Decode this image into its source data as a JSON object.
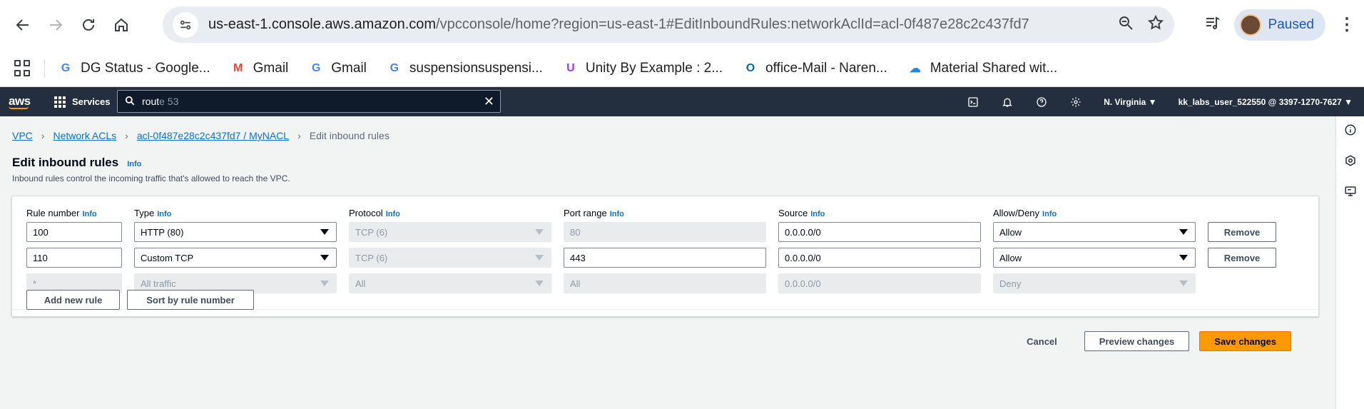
{
  "browser": {
    "url_host": "us-east-1.console.aws.amazon.com",
    "url_path": "/vpcconsole/home?region=us-east-1#EditInboundRules:networkAclId=acl-0f487e28c2c437fd7",
    "profile_label": "Paused",
    "icons": [
      "back-icon",
      "forward-icon",
      "reload-icon",
      "home-icon",
      "site-info-icon",
      "zoom-icon",
      "bookmark-star-icon",
      "media-icon",
      "menu-icon"
    ]
  },
  "bookmarks": [
    {
      "label": "DG Status - Google...",
      "icon": "google-icon",
      "color": "#4285f4",
      "glyph": "G"
    },
    {
      "label": "Gmail",
      "icon": "gmail-icon",
      "color": "#ea4335",
      "glyph": "M"
    },
    {
      "label": "Gmail",
      "icon": "google-icon",
      "color": "#4285f4",
      "glyph": "G"
    },
    {
      "label": "suspensionsuspensi...",
      "icon": "google-icon",
      "color": "#4285f4",
      "glyph": "G"
    },
    {
      "label": "Unity By Example : 2...",
      "icon": "udemy-icon",
      "color": "#a435f0",
      "glyph": "U"
    },
    {
      "label": "office-Mail - Naren...",
      "icon": "outlook-icon",
      "color": "#0a64b4",
      "glyph": "O"
    },
    {
      "label": "Material Shared wit...",
      "icon": "onedrive-icon",
      "color": "#1e88e5",
      "glyph": "☁"
    }
  ],
  "aws_nav": {
    "logo": "aws",
    "services_label": "Services",
    "search_typed": "rout",
    "search_suggestion": "e 53",
    "region": "N. Virginia",
    "account": "kk_labs_user_522550 @ 3397-1270-7627"
  },
  "breadcrumb": {
    "items": [
      "VPC",
      "Network ACLs",
      "acl-0f487e28c2c437fd7 / MyNACL"
    ],
    "current": "Edit inbound rules"
  },
  "page": {
    "title": "Edit inbound rules",
    "info": "Info",
    "description": "Inbound rules control the incoming traffic that's allowed to reach the VPC."
  },
  "table": {
    "headers": [
      "Rule number",
      "Type",
      "Protocol",
      "Port range",
      "Source",
      "Allow/Deny"
    ],
    "info": "Info",
    "rows": [
      {
        "rule": "100",
        "type": "HTTP (80)",
        "protocol": "TCP (6)",
        "port": "80",
        "source": "0.0.0.0/0",
        "action": "Allow",
        "remove": "Remove"
      },
      {
        "rule": "110",
        "type": "Custom TCP",
        "protocol": "TCP (6)",
        "port": "443",
        "source": "0.0.0.0/0",
        "action": "Allow",
        "remove": "Remove"
      },
      {
        "rule": "*",
        "type": "All traffic",
        "protocol": "All",
        "port": "All",
        "source": "0.0.0.0/0",
        "action": "Deny"
      }
    ],
    "add_rule": "Add new rule",
    "sort_rule": "Sort by rule number"
  },
  "actions": {
    "cancel": "Cancel",
    "preview": "Preview changes",
    "save": "Save changes"
  }
}
